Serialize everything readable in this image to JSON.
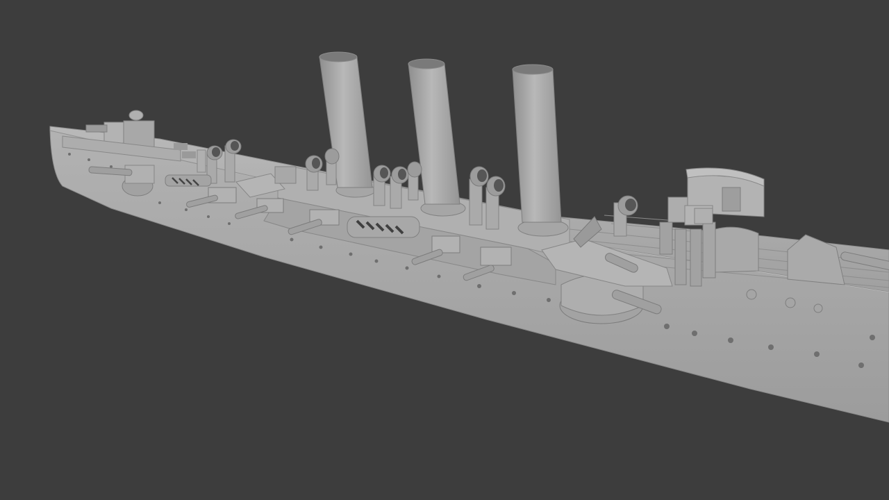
{
  "viewport": {
    "background_color": "#3d3d3d",
    "model_color": "#a9a9a9",
    "model_shadow_color": "#7e7e7e",
    "model_highlight_color": "#c4c4c4",
    "model_dark_color": "#5a5a5a",
    "model": {
      "name": "cruiser-hull",
      "funnel_count": 3,
      "view": "perspective"
    }
  }
}
